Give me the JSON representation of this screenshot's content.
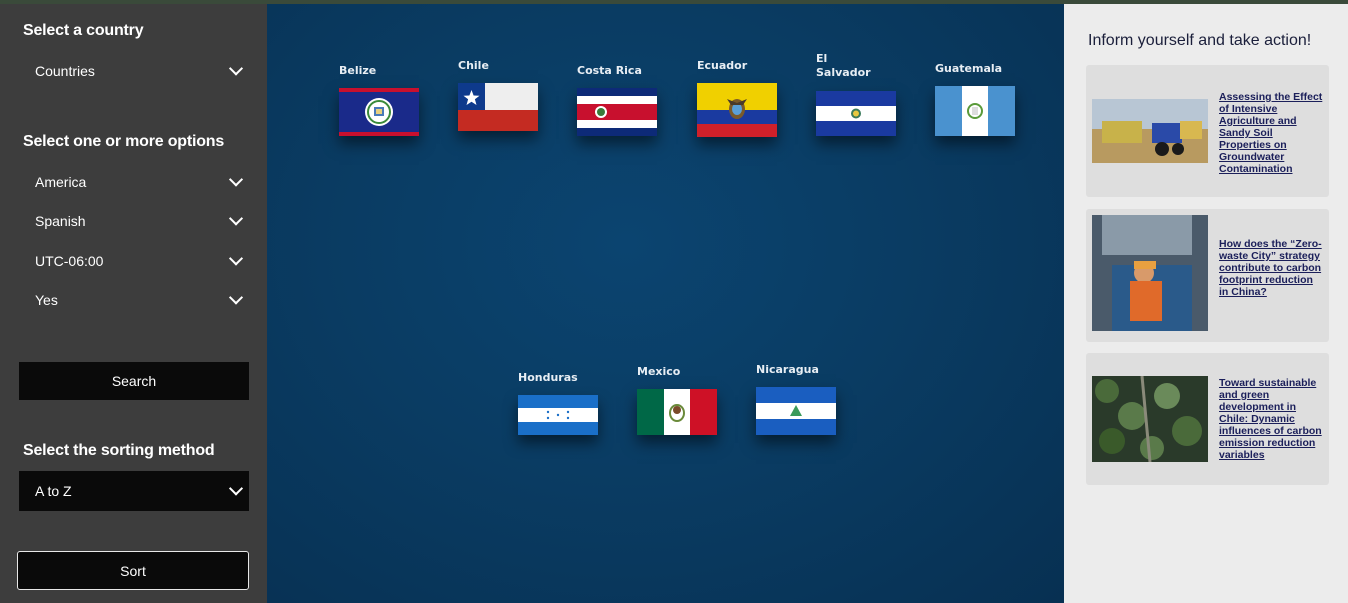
{
  "sidebar": {
    "country_title": "Select a country",
    "country_select": "Countries",
    "options_title": "Select one or more options",
    "options": [
      "America",
      "Spanish",
      "UTC-06:00",
      "Yes"
    ],
    "search_button": "Search",
    "sort_title": "Select the sorting method",
    "sort_select": "A to Z",
    "sort_button": "Sort"
  },
  "countries": [
    "Belize",
    "Chile",
    "Costa Rica",
    "Ecuador",
    "El Salvador",
    "Guatemala",
    "Honduras",
    "Mexico",
    "Nicaragua"
  ],
  "right_panel": {
    "title": "Inform yourself and take action!",
    "articles": [
      "Assessing the Effect of Intensive Agriculture and Sandy Soil Properties on Groundwater Contamination",
      "How does the “Zero-waste City” strategy contribute to carbon footprint reduction in China?",
      "Toward sustainable and green development in Chile: Dynamic influences of carbon emission reduction variables"
    ]
  },
  "colors": {
    "sidebar_bg": "#3d3d3d",
    "button_bg": "#0a0a0a",
    "main_bg": "#0a3c63",
    "panel_bg": "#ececec",
    "card_bg": "#dedede",
    "link_color": "#1b1f5a"
  }
}
